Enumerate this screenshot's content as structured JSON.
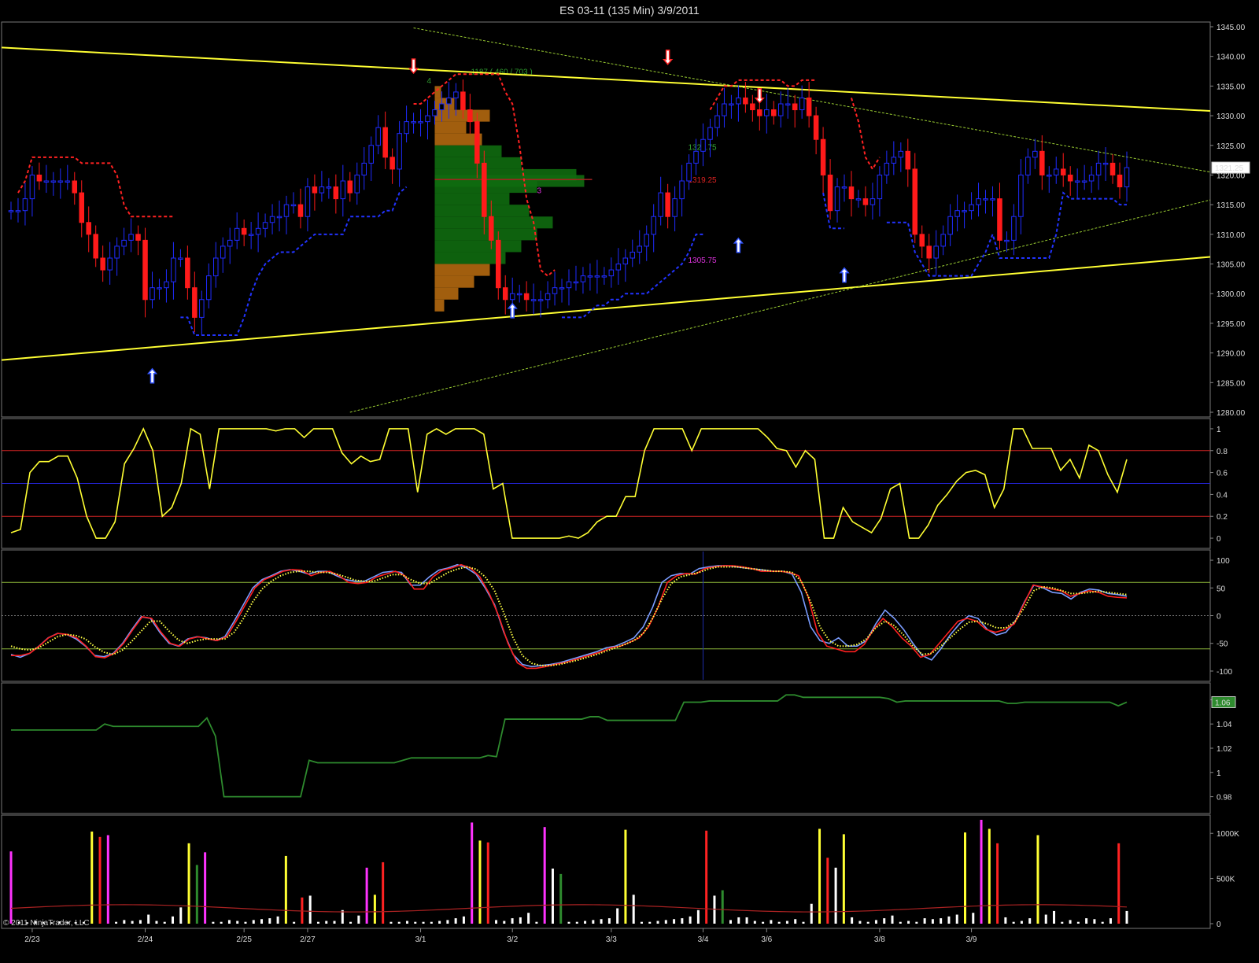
{
  "chart_data": {
    "type": "candlestick",
    "title": "ES 03-11 (135 Min)  3/9/2011",
    "copyright": "© 2011 NinjaTrader, LLC",
    "x_ticks": [
      "2/23",
      "2/24",
      "2/25",
      "2/27",
      "3/1",
      "3/2",
      "3/3",
      "3/4",
      "3/6",
      "3/8",
      "3/9"
    ],
    "colors": {
      "up": "#1f2cff",
      "down": "#ff1a1a",
      "trend": "#ffff33",
      "channel": "#9acd32",
      "stop_up": "#2233ff",
      "stop_down": "#ff2222"
    },
    "price_panel": {
      "ylim": [
        1280,
        1345
      ],
      "y_ticks": [
        "1280.00",
        "1285.00",
        "1290.00",
        "1295.00",
        "1300.00",
        "1305.00",
        "1310.00",
        "1315.00",
        "1320.00",
        "1325.00",
        "1330.00",
        "1335.00",
        "1340.00",
        "1345.00"
      ],
      "last_price": "1321.25",
      "close": [
        1314,
        1314,
        1316,
        1320,
        1319,
        1319,
        1319,
        1319,
        1319,
        1317,
        1312,
        1310,
        1306,
        1304,
        1306,
        1308,
        1309,
        1310,
        1309,
        1299,
        1301,
        1301,
        1302,
        1306,
        1306,
        1301,
        1296,
        1299,
        1303,
        1306,
        1308,
        1309,
        1311,
        1310,
        1310,
        1311,
        1312,
        1313,
        1313,
        1315,
        1315,
        1313,
        1318,
        1317,
        1318,
        1318,
        1316,
        1319,
        1317,
        1320,
        1322,
        1325,
        1328,
        1323,
        1321,
        1327,
        1329,
        1329,
        1329,
        1330,
        1331,
        1332,
        1333,
        1334,
        1331,
        1329,
        1322,
        1313,
        1309,
        1301,
        1299,
        1300,
        1300,
        1299,
        1299,
        1299,
        1300,
        1301,
        1301,
        1302,
        1302,
        1303,
        1303,
        1303,
        1303,
        1304,
        1305,
        1306,
        1307,
        1308,
        1310,
        1313,
        1317,
        1313,
        1316,
        1319,
        1322,
        1324,
        1326,
        1328,
        1330,
        1332,
        1332,
        1333,
        1332,
        1331,
        1330,
        1331,
        1330,
        1332,
        1332,
        1331,
        1333,
        1330,
        1326,
        1320,
        1314,
        1318,
        1318,
        1316,
        1316,
        1315,
        1316,
        1320,
        1322,
        1323,
        1324,
        1321,
        1310,
        1308,
        1306,
        1308,
        1310,
        1313,
        1314,
        1314,
        1315,
        1316,
        1316,
        1316,
        1309,
        1309,
        1313,
        1320,
        1323,
        1324,
        1320,
        1320,
        1321,
        1320,
        1319,
        1319,
        1319,
        1320,
        1322,
        1322,
        1320,
        1318,
        1321.25
      ],
      "volume_profile_labels": {
        "poc": "1319.25",
        "vah": "1324.75",
        "val": "1305.75",
        "info": "1187 ( 460 / 703 )",
        "count_a": "4",
        "count_b": "3"
      }
    },
    "oscillator_panel": {
      "ylim": [
        -0.05,
        1.05
      ],
      "y_ticks": [
        "0",
        "0.2",
        "0.4",
        "0.6",
        "0.8",
        "1"
      ],
      "levels": [
        0.2,
        0.5,
        0.8
      ],
      "values": [
        0.05,
        0.08,
        0.6,
        0.7,
        0.7,
        0.75,
        0.75,
        0.55,
        0.2,
        0.0,
        0.0,
        0.15,
        0.68,
        0.82,
        1.0,
        0.8,
        0.2,
        0.28,
        0.5,
        1.0,
        0.95,
        0.45,
        1.0,
        1.0,
        1.0,
        1.0,
        1.0,
        1.0,
        0.98,
        1.0,
        1.0,
        0.92,
        1.0,
        1.0,
        1.0,
        0.78,
        0.68,
        0.75,
        0.7,
        0.72,
        1.0,
        1.0,
        1.0,
        0.42,
        0.95,
        1.0,
        0.95,
        1.0,
        1.0,
        1.0,
        0.95,
        0.45,
        0.5,
        0.0,
        0.0,
        0.0,
        0.0,
        0.0,
        0.0,
        0.02,
        0.0,
        0.05,
        0.15,
        0.2,
        0.2,
        0.38,
        0.38,
        0.8,
        1.0,
        1.0,
        1.0,
        1.0,
        0.8,
        1.0,
        1.0,
        1.0,
        1.0,
        1.0,
        1.0,
        1.0,
        0.92,
        0.82,
        0.8,
        0.65,
        0.8,
        0.72,
        0.0,
        0.0,
        0.28,
        0.15,
        0.1,
        0.05,
        0.18,
        0.45,
        0.5,
        0.0,
        0.0,
        0.12,
        0.3,
        0.4,
        0.52,
        0.6,
        0.62,
        0.58,
        0.28,
        0.45,
        1.0,
        1.0,
        0.82,
        0.82,
        0.82,
        0.62,
        0.72,
        0.55,
        0.85,
        0.8,
        0.58,
        0.42,
        0.72
      ]
    },
    "stochastic_panel": {
      "ylim": [
        -110,
        110
      ],
      "y_ticks": [
        "-100",
        "-50",
        "0",
        "50",
        "100"
      ],
      "levels": [
        -60,
        0,
        60
      ],
      "series": [
        {
          "color": "#7a9cff",
          "values": [
            -70,
            -75,
            -68,
            -55,
            -40,
            -32,
            -34,
            -42,
            -55,
            -72,
            -74,
            -68,
            -50,
            -25,
            -2,
            -5,
            -30,
            -50,
            -55,
            -42,
            -38,
            -40,
            -45,
            -38,
            -10,
            20,
            50,
            65,
            72,
            80,
            83,
            80,
            75,
            80,
            80,
            72,
            65,
            62,
            62,
            70,
            78,
            80,
            78,
            55,
            55,
            70,
            82,
            86,
            92,
            86,
            75,
            50,
            20,
            -30,
            -70,
            -88,
            -92,
            -90,
            -88,
            -85,
            -80,
            -75,
            -70,
            -65,
            -58,
            -55,
            -48,
            -40,
            -20,
            15,
            60,
            72,
            76,
            75,
            85,
            88,
            90,
            90,
            88,
            86,
            84,
            82,
            80,
            80,
            75,
            42,
            -20,
            -45,
            -50,
            -40,
            -55,
            -55,
            -45,
            -15,
            10,
            -5,
            -25,
            -50,
            -72,
            -80,
            -60,
            -35,
            -15,
            0,
            -5,
            -25,
            -35,
            -30,
            -10,
            25,
            55,
            50,
            42,
            40,
            30,
            42,
            48,
            46,
            40,
            38,
            35
          ]
        },
        {
          "color": "#ff2020",
          "values": [
            -72,
            -72,
            -68,
            -55,
            -40,
            -32,
            -34,
            -40,
            -55,
            -74,
            -76,
            -68,
            -50,
            -25,
            -2,
            -5,
            -30,
            -50,
            -55,
            -42,
            -38,
            -42,
            -45,
            -38,
            -10,
            20,
            50,
            65,
            72,
            80,
            83,
            82,
            72,
            78,
            80,
            72,
            60,
            58,
            60,
            70,
            75,
            80,
            72,
            48,
            48,
            70,
            82,
            86,
            92,
            86,
            70,
            40,
            0,
            -50,
            -85,
            -95,
            -95,
            -92,
            -88,
            -85,
            -80,
            -75,
            -70,
            -65,
            -58,
            -55,
            -48,
            -40,
            -20,
            15,
            60,
            72,
            76,
            75,
            85,
            88,
            90,
            90,
            88,
            85,
            80,
            80,
            80,
            78,
            72,
            35,
            -30,
            -55,
            -60,
            -65,
            -65,
            -52,
            -25,
            -5,
            -20,
            -40,
            -55,
            -75,
            -70,
            -50,
            -30,
            -10,
            -5,
            -10,
            -25,
            -30,
            -25,
            -15,
            20,
            55,
            52,
            48,
            45,
            35,
            40,
            45,
            42,
            35,
            33,
            32
          ]
        },
        {
          "color": "#ffff44",
          "dotted": true,
          "values": [
            -55,
            -60,
            -62,
            -58,
            -48,
            -38,
            -34,
            -36,
            -42,
            -56,
            -66,
            -70,
            -62,
            -46,
            -28,
            -10,
            -10,
            -28,
            -44,
            -50,
            -45,
            -42,
            -42,
            -42,
            -30,
            -5,
            25,
            48,
            62,
            72,
            78,
            80,
            80,
            78,
            78,
            75,
            70,
            64,
            62,
            62,
            68,
            74,
            74,
            65,
            58,
            58,
            68,
            78,
            84,
            88,
            84,
            70,
            45,
            5,
            -40,
            -72,
            -86,
            -90,
            -90,
            -88,
            -84,
            -80,
            -75,
            -70,
            -64,
            -58,
            -52,
            -45,
            -32,
            -5,
            30,
            58,
            70,
            74,
            78,
            84,
            88,
            88,
            88,
            86,
            84,
            82,
            80,
            80,
            78,
            62,
            25,
            -20,
            -45,
            -55,
            -55,
            -52,
            -42,
            -22,
            -10,
            -18,
            -35,
            -55,
            -70,
            -68,
            -55,
            -40,
            -25,
            -12,
            -10,
            -15,
            -22,
            -22,
            -10,
            15,
            45,
            52,
            50,
            45,
            40,
            40,
            42,
            44,
            42,
            40,
            38
          ]
        }
      ]
    },
    "ratio_panel": {
      "ylim": [
        0.97,
        1.07
      ],
      "y_ticks": [
        "0.98",
        "1",
        "1.02",
        "1.04",
        "1.06"
      ],
      "last_value": "1.06",
      "color": "#2e8b2e",
      "values": [
        1.035,
        1.035,
        1.035,
        1.035,
        1.035,
        1.035,
        1.035,
        1.035,
        1.035,
        1.035,
        1.035,
        1.04,
        1.038,
        1.038,
        1.038,
        1.038,
        1.038,
        1.038,
        1.038,
        1.038,
        1.038,
        1.038,
        1.038,
        1.045,
        1.03,
        0.98,
        0.98,
        0.98,
        0.98,
        0.98,
        0.98,
        0.98,
        0.98,
        0.98,
        0.98,
        1.01,
        1.008,
        1.008,
        1.008,
        1.008,
        1.008,
        1.008,
        1.008,
        1.008,
        1.008,
        1.008,
        1.01,
        1.012,
        1.012,
        1.012,
        1.012,
        1.012,
        1.012,
        1.012,
        1.012,
        1.012,
        1.014,
        1.013,
        1.044,
        1.044,
        1.044,
        1.044,
        1.044,
        1.044,
        1.044,
        1.044,
        1.044,
        1.044,
        1.046,
        1.046,
        1.043,
        1.043,
        1.043,
        1.043,
        1.043,
        1.043,
        1.043,
        1.043,
        1.043,
        1.058,
        1.058,
        1.058,
        1.059,
        1.059,
        1.059,
        1.059,
        1.059,
        1.059,
        1.059,
        1.059,
        1.059,
        1.064,
        1.064,
        1.062,
        1.062,
        1.062,
        1.062,
        1.062,
        1.062,
        1.062,
        1.062,
        1.062,
        1.062,
        1.061,
        1.058,
        1.059,
        1.059,
        1.059,
        1.059,
        1.059,
        1.059,
        1.059,
        1.059,
        1.059,
        1.059,
        1.059,
        1.059,
        1.057,
        1.057,
        1.058,
        1.058,
        1.058,
        1.058,
        1.058,
        1.058,
        1.058,
        1.058,
        1.058,
        1.058,
        1.058,
        1.055,
        1.058
      ]
    },
    "volume_panel": {
      "ylim": [
        0,
        1150000
      ],
      "y_ticks": [
        "0",
        "500K",
        "1000K"
      ],
      "values": [
        800000,
        20000,
        15000,
        30000,
        20000,
        15000,
        25000,
        20000,
        18000,
        20000,
        1020000,
        960000,
        980000,
        20000,
        40000,
        30000,
        40000,
        100000,
        30000,
        20000,
        80000,
        180000,
        890000,
        650000,
        790000,
        20000,
        20000,
        40000,
        30000,
        20000,
        40000,
        50000,
        60000,
        80000,
        750000,
        20000,
        290000,
        310000,
        20000,
        30000,
        30000,
        150000,
        20000,
        90000,
        620000,
        320000,
        680000,
        20000,
        20000,
        30000,
        20000,
        20000,
        20000,
        30000,
        40000,
        60000,
        80000,
        1120000,
        920000,
        900000,
        40000,
        30000,
        60000,
        70000,
        120000,
        20000,
        1070000,
        610000,
        550000,
        20000,
        20000,
        30000,
        40000,
        50000,
        60000,
        170000,
        1040000,
        320000,
        20000,
        20000,
        30000,
        40000,
        50000,
        60000,
        80000,
        150000,
        1030000,
        310000,
        370000,
        40000,
        70000,
        70000,
        30000,
        20000,
        40000,
        20000,
        30000,
        50000,
        20000,
        220000,
        1050000,
        730000,
        620000,
        990000,
        70000,
        30000,
        20000,
        40000,
        60000,
        90000,
        20000,
        30000,
        20000,
        60000,
        50000,
        60000,
        80000,
        100000,
        1010000,
        120000,
        1150000,
        1050000,
        890000,
        70000,
        20000,
        30000,
        60000,
        980000,
        100000,
        140000,
        20000,
        40000,
        20000,
        60000,
        50000,
        20000,
        60000,
        890000,
        140000
      ]
    }
  }
}
